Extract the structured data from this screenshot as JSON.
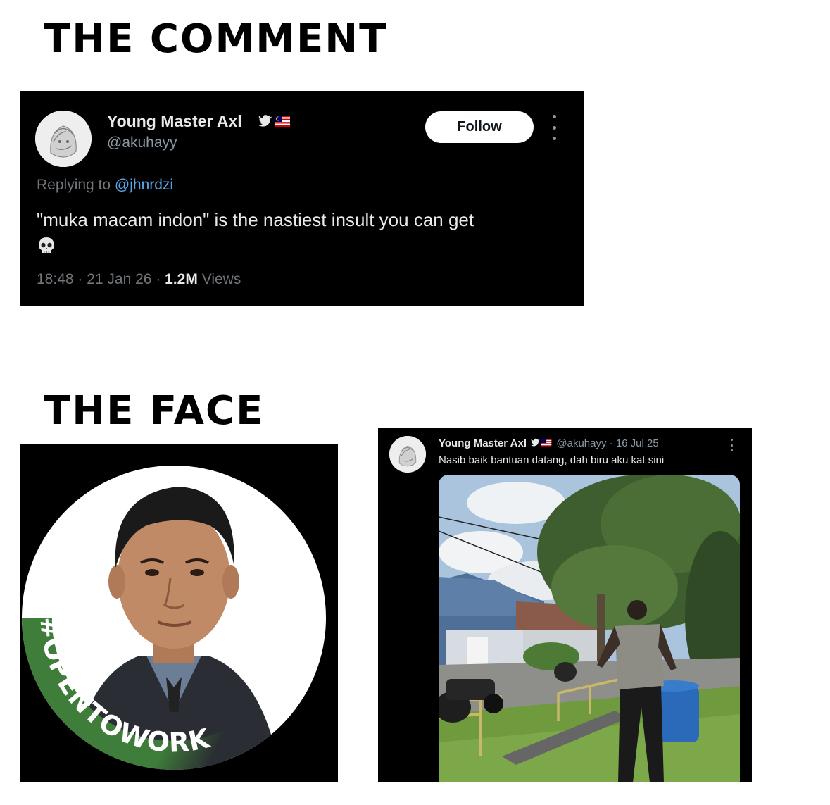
{
  "headings": {
    "comment": "THE COMMENT",
    "face": "THE FACE"
  },
  "tweet1": {
    "display_name": "Young Master Axl",
    "handle": "@akuhayy",
    "follow_label": "Follow",
    "replying_prefix": "Replying to",
    "replying_handle": "@jhnrdzi",
    "text": "\"muka macam indon\" is the nastiest insult you can get",
    "emoji": "skull-emoji",
    "time": "18:48",
    "date": "21 Jan 26",
    "views_count": "1.2M",
    "views_label": "Views",
    "badge_icons": [
      "twitter-bird-icon",
      "malaysia-flag-icon"
    ],
    "colors": {
      "background": "#000000",
      "mention": "#5aa4e8",
      "muted": "#71767b"
    }
  },
  "profile_photo": {
    "frame_text": "#OPENTOWORK",
    "frame_color": "#3f7d3a"
  },
  "tweet2": {
    "display_name": "Young Master Axl",
    "handle": "@akuhayy",
    "separator": "·",
    "date": "16 Jul 25",
    "text": "Nasib baik bantuan datang, dah biru aku kat sini",
    "badge_icons": [
      "twitter-bird-icon",
      "malaysia-flag-icon"
    ],
    "media_icon": "street-photo-image"
  }
}
